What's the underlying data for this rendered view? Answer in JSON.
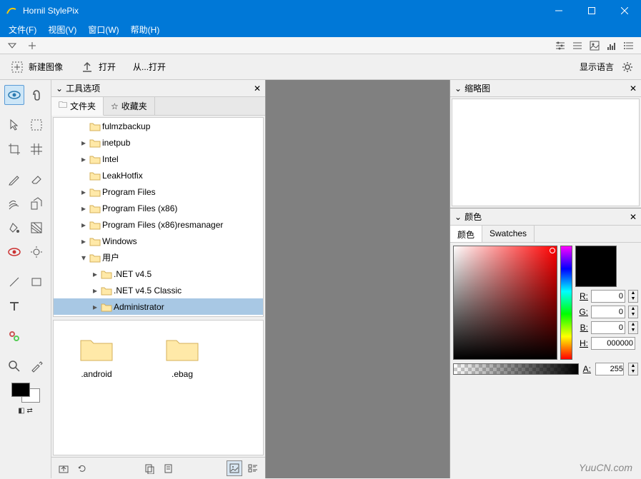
{
  "title": "Hornil StylePix",
  "menu": {
    "file": "文件(F)",
    "view": "视图(V)",
    "window": "窗口(W)",
    "help": "帮助(H)"
  },
  "toolbar2": {
    "newImage": "新建图像",
    "open": "打开",
    "openFrom": "从...打开",
    "showLang": "显示语言"
  },
  "leftPanel": {
    "title": "工具选项",
    "tabFolder": "文件夹",
    "tabFav": "收藏夹"
  },
  "tree": {
    "items": [
      {
        "indent": 1,
        "exp": "",
        "name": "fulmzbackup"
      },
      {
        "indent": 1,
        "exp": "▸",
        "name": "inetpub"
      },
      {
        "indent": 1,
        "exp": "▸",
        "name": "Intel"
      },
      {
        "indent": 1,
        "exp": "",
        "name": "LeakHotfix"
      },
      {
        "indent": 1,
        "exp": "▸",
        "name": "Program Files"
      },
      {
        "indent": 1,
        "exp": "▸",
        "name": "Program Files (x86)"
      },
      {
        "indent": 1,
        "exp": "▸",
        "name": "Program Files (x86)resmanager"
      },
      {
        "indent": 1,
        "exp": "▸",
        "name": "Windows"
      },
      {
        "indent": 1,
        "exp": "▾",
        "name": "用户"
      },
      {
        "indent": 2,
        "exp": "▸",
        "name": ".NET v4.5"
      },
      {
        "indent": 2,
        "exp": "▸",
        "name": ".NET v4.5 Classic"
      },
      {
        "indent": 2,
        "exp": "▸",
        "name": "Administrator",
        "selected": true
      }
    ]
  },
  "thumbs": {
    "a": ".android",
    "b": ".ebag"
  },
  "rightThumb": {
    "title": "缩略图"
  },
  "colorPanel": {
    "title": "颜色",
    "tabColor": "颜色",
    "tabSwatch": "Swatches",
    "R": "R:",
    "G": "G:",
    "B": "B:",
    "H": "H:",
    "A": "A:",
    "rVal": "0",
    "gVal": "0",
    "bVal": "0",
    "hVal": "000000",
    "aVal": "255"
  },
  "watermark": "YuuCN.com"
}
